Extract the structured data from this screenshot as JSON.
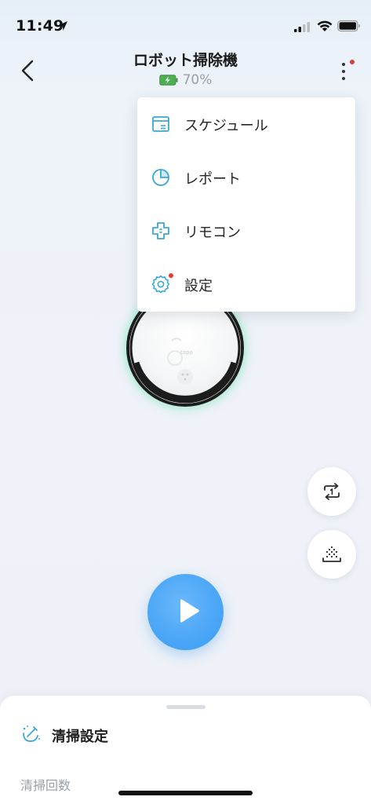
{
  "status_bar": {
    "time": "11:49",
    "location_icon": "location-arrow-icon",
    "signal_icon": "cellular-signal-icon",
    "wifi_icon": "wifi-icon",
    "battery_icon": "battery-icon"
  },
  "header": {
    "back_icon": "chevron-left-icon",
    "title": "ロボット掃除機",
    "battery_percent": "70%",
    "battery_icon": "charging-battery-icon",
    "more_icon": "more-vertical-icon",
    "notification_dot_color": "#e53935"
  },
  "menu": {
    "items": [
      {
        "label": "スケジュール",
        "icon": "calendar-icon"
      },
      {
        "label": "レポート",
        "icon": "pie-chart-icon"
      },
      {
        "label": "リモコン",
        "icon": "remote-control-icon"
      },
      {
        "label": "設定",
        "icon": "gear-icon"
      }
    ]
  },
  "robot": {
    "brand": "tapo",
    "glow_color": "#58e2ac"
  },
  "side_buttons": {
    "repeat_once_icon": "repeat-once-icon",
    "dust_bin_icon": "dust-bin-icon"
  },
  "start_button": {
    "icon": "play-icon",
    "color": "#4aa6f6"
  },
  "bottom_sheet": {
    "icon": "cleaning-settings-icon",
    "title": "清掃設定",
    "clean_count_label": "清掃回数"
  },
  "colors": {
    "accent": "#4aa6f6",
    "icon_teal": "#3aa8d8",
    "battery_green": "#4caf50"
  }
}
